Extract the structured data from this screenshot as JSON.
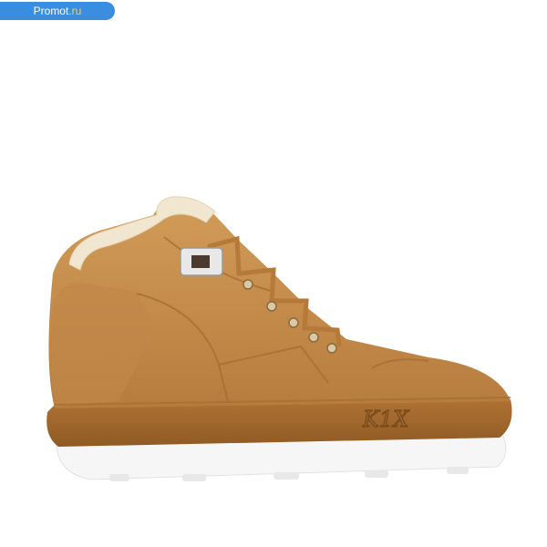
{
  "watermark": {
    "name": "Promot",
    "tld": ".ru",
    "color": "#3b8de0"
  },
  "product": {
    "logo_text": "K1X",
    "colors": {
      "upper": "#c9914e",
      "upper_shade": "#a86e34",
      "sole": "#a4682c",
      "midsole": "#ffffff",
      "fur": "#f1e6d0"
    }
  }
}
